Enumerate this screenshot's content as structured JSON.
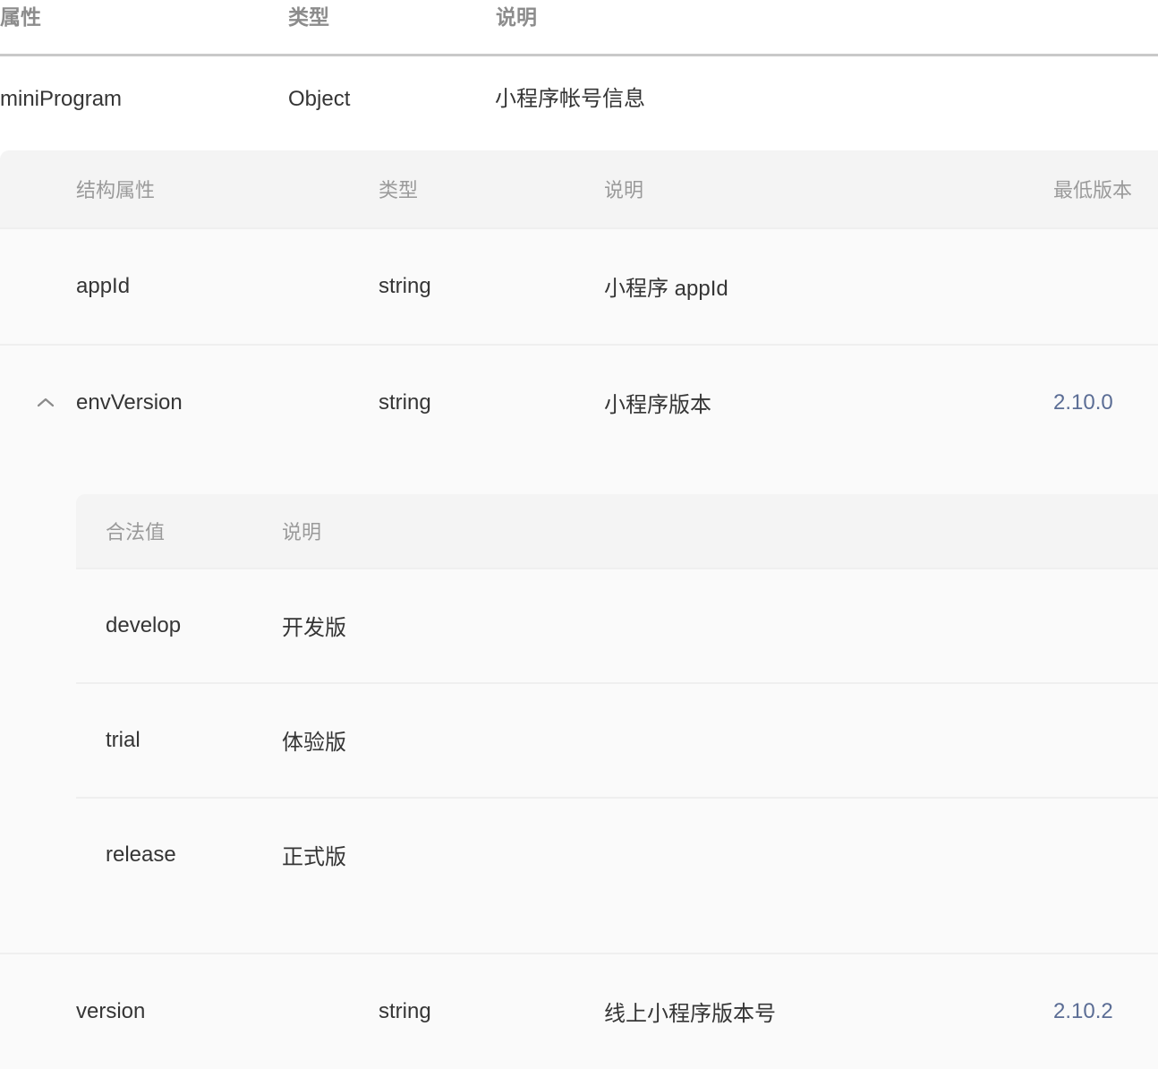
{
  "outer_table": {
    "headers": [
      "属性",
      "类型",
      "说明"
    ],
    "rows": [
      {
        "attr": "miniProgram",
        "type": "Object",
        "desc": "小程序帐号信息"
      }
    ]
  },
  "nested_table": {
    "headers": [
      "结构属性",
      "类型",
      "说明",
      "最低版本"
    ],
    "rows": [
      {
        "name": "appId",
        "type": "string",
        "desc": "小程序 appId",
        "version": "",
        "expandable": false
      },
      {
        "name": "envVersion",
        "type": "string",
        "desc": "小程序版本",
        "version": "2.10.0",
        "expandable": true,
        "toggle_icon": "chevron-up-icon"
      },
      {
        "name": "version",
        "type": "string",
        "desc": "线上小程序版本号",
        "version": "2.10.2",
        "expandable": false
      }
    ]
  },
  "sub_table": {
    "headers": [
      "合法值",
      "说明"
    ],
    "rows": [
      {
        "value": "develop",
        "desc": "开发版"
      },
      {
        "value": "trial",
        "desc": "体验版"
      },
      {
        "value": "release",
        "desc": "正式版"
      }
    ]
  },
  "colors": {
    "version_link": "#5b6d95",
    "header_text": "#9a9a9a",
    "body_text": "#353535",
    "panel_bg": "#fafafa",
    "panel_header_bg": "#f4f4f4"
  }
}
